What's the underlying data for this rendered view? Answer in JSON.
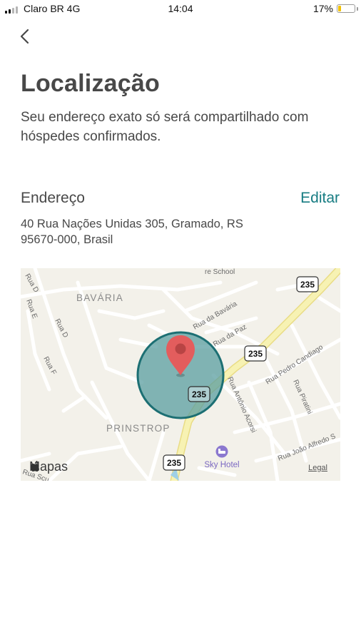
{
  "status_bar": {
    "carrier": "Claro BR  4G",
    "time": "14:04",
    "battery_percent_label": "17%",
    "battery_level": 0.17
  },
  "page": {
    "title": "Localização",
    "description": "Seu endereço exato só será compartilhado com hóspedes confirmados."
  },
  "address_section": {
    "label": "Endereço",
    "edit_label": "Editar",
    "address_line1": "40 Rua Nações Unidas 305, Gramado, RS",
    "address_line2": "95670-000, Brasil"
  },
  "map": {
    "brand": "Mapas",
    "legal": "Legal",
    "district_labels": [
      "BAVÁRIA",
      "PRINSTROP"
    ],
    "street_labels": [
      "Rua da Bavária",
      "Rua da Paz",
      "Rua Antônio Acorsi",
      "Rua Pedro Candiago",
      "Rua Piratini",
      "Rua João Alfredo S",
      "Rua D",
      "Rua E",
      "Rua F",
      "Rua D",
      "re School",
      "Rua Scu"
    ],
    "route_shield": "235",
    "poi_name": "Sky Hotel",
    "colors": {
      "background": "#f3f1ea",
      "highway": "#f4efa6",
      "circle_fill": "#5a9ea0",
      "circle_stroke": "#1c6f73",
      "pin": "#e35d5d",
      "poi": "#8b78cf"
    }
  }
}
